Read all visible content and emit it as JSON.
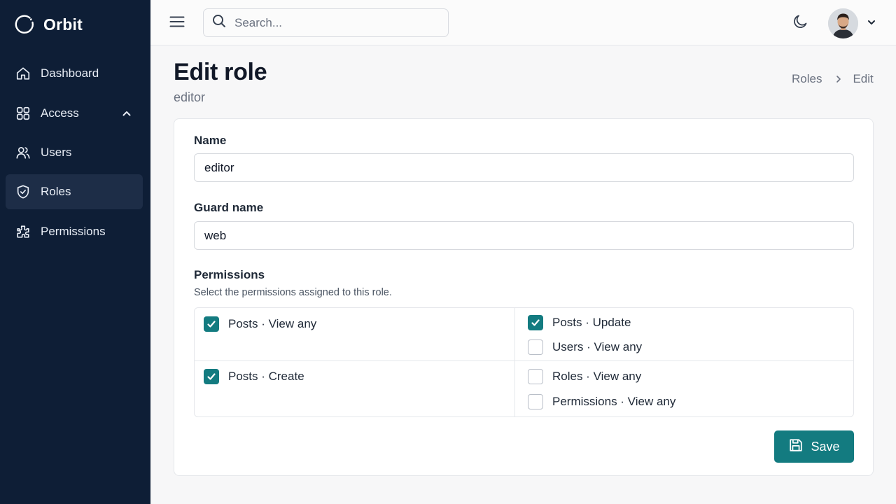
{
  "app": {
    "name": "Orbit"
  },
  "sidebar": {
    "items": [
      {
        "label": "Dashboard",
        "icon": "home-icon"
      },
      {
        "label": "Access",
        "icon": "grid-icon",
        "expanded": true
      },
      {
        "label": "Users",
        "icon": "users-icon"
      },
      {
        "label": "Roles",
        "icon": "shield-icon",
        "active": true
      },
      {
        "label": "Permissions",
        "icon": "puzzle-icon"
      }
    ]
  },
  "topbar": {
    "search_placeholder": "Search...",
    "theme_icon": "moon-icon"
  },
  "page": {
    "title": "Edit role",
    "subtitle": "editor",
    "breadcrumb": [
      "Roles",
      "Edit"
    ]
  },
  "form": {
    "name_label": "Name",
    "name_value": "editor",
    "guard_label": "Guard name",
    "guard_value": "web",
    "permissions_label": "Permissions",
    "permissions_help": "Select the permissions assigned to this role.",
    "permissions": [
      {
        "label": "Posts · View any",
        "checked": true
      },
      {
        "label": "Posts · Update",
        "checked": true
      },
      {
        "label": "Users · View any",
        "checked": false
      },
      {
        "label": "Posts · Create",
        "checked": true
      },
      {
        "label": "Roles · View any",
        "checked": false
      },
      {
        "label": "Permissions · View any",
        "checked": false
      }
    ],
    "save_label": "Save"
  },
  "colors": {
    "sidebar_bg": "#0e1e36",
    "accent": "#137b80"
  }
}
